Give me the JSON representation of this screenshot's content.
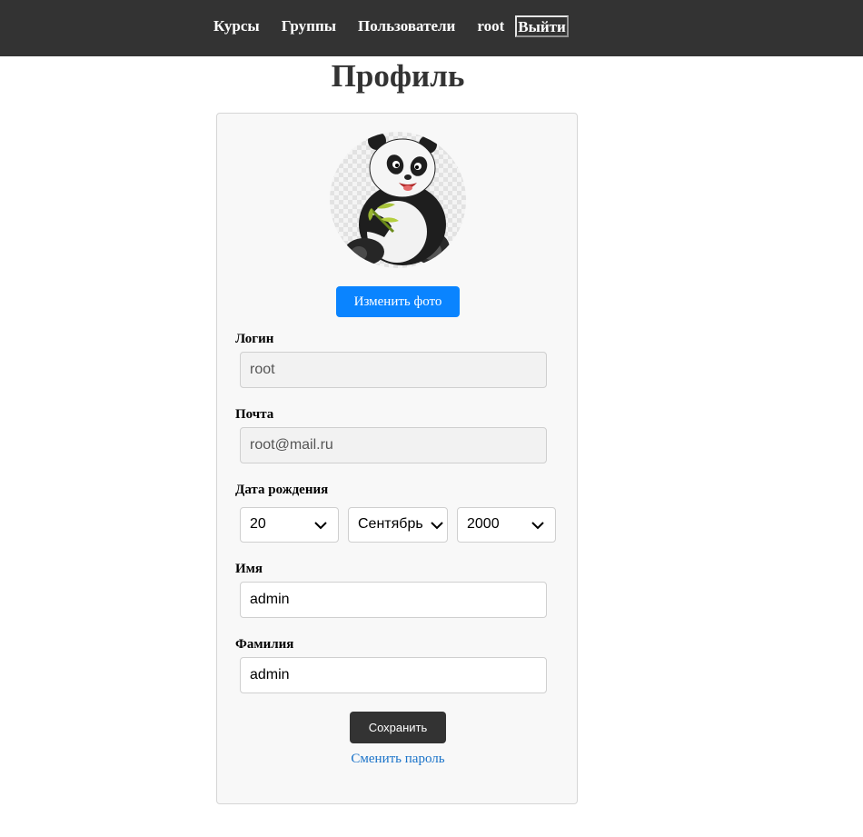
{
  "nav": {
    "courses": "Курсы",
    "groups": "Группы",
    "users": "Пользователи",
    "username": "root",
    "logout": "Выйти"
  },
  "page": {
    "title": "Профиль"
  },
  "profile": {
    "avatar_icon": "panda-avatar-icon",
    "change_photo": "Изменить фото",
    "login_label": "Логин",
    "login_value": "root",
    "email_label": "Почта",
    "email_value": "root@mail.ru",
    "birth_label": "Дата рождения",
    "birth_day": "20",
    "birth_month": "Сентябрь",
    "birth_year": "2000",
    "first_name_label": "Имя",
    "first_name_value": "admin",
    "last_name_label": "Фамилия",
    "last_name_value": "admin",
    "save": "Сохранить",
    "change_password": "Сменить пароль"
  },
  "colors": {
    "topbar": "#333333",
    "primary_button": "#0a84ff",
    "save_button": "#333333",
    "link": "#1a73c9"
  }
}
